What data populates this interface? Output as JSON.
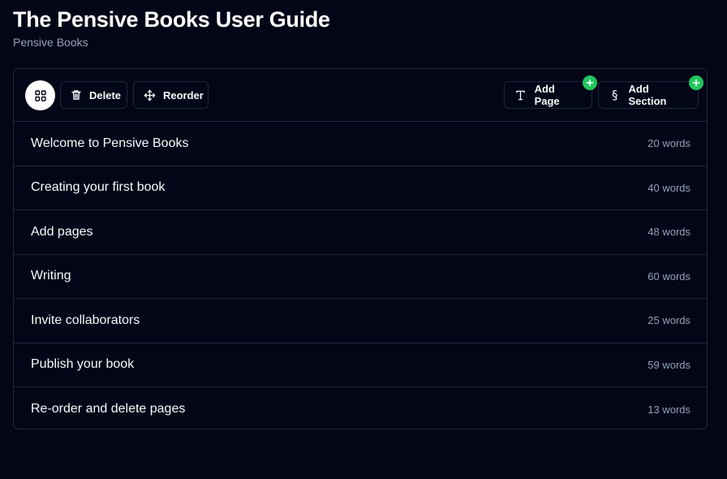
{
  "book": {
    "title": "The Pensive Books User Guide",
    "subtitle": "Pensive Books"
  },
  "toolbar": {
    "delete_label": "Delete",
    "reorder_label": "Reorder",
    "add_page_label": "Add Page",
    "add_section_label": "Add Section"
  },
  "pages": [
    {
      "title": "Welcome to Pensive Books",
      "count": "20 words"
    },
    {
      "title": "Creating your first book",
      "count": "40 words"
    },
    {
      "title": "Add pages",
      "count": "48 words"
    },
    {
      "title": "Writing",
      "count": "60 words"
    },
    {
      "title": "Invite collaborators",
      "count": "25 words"
    },
    {
      "title": "Publish your book",
      "count": "59 words"
    },
    {
      "title": "Re-order and delete pages",
      "count": "13 words"
    }
  ],
  "colors": {
    "background": "#020617",
    "border": "#1e293b",
    "muted_text": "#94a3b8",
    "accent_green": "#22c55e"
  },
  "icons": {
    "grid": "grid-icon",
    "delete": "trash-icon",
    "reorder": "move-icon",
    "add_page": "text-icon",
    "add_section": "section-sign-icon",
    "badge": "plus-icon"
  }
}
